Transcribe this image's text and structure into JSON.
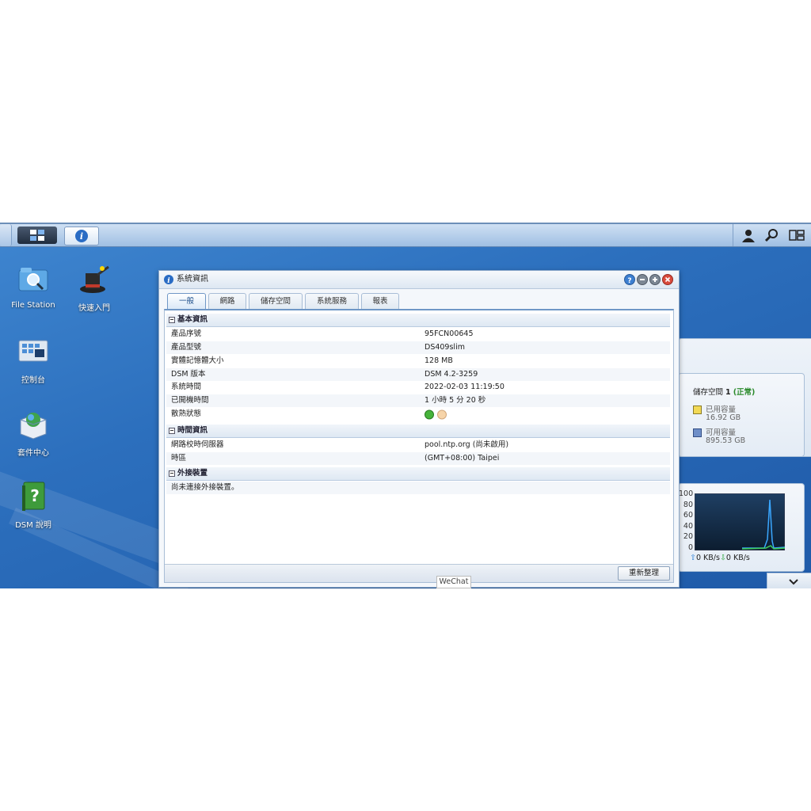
{
  "desktop": {
    "icons": [
      {
        "label": "File Station"
      },
      {
        "label": "快速入門"
      },
      {
        "label": "控制台"
      },
      {
        "label": "套件中心"
      },
      {
        "label": "DSM 說明"
      }
    ]
  },
  "window": {
    "title": "系統資訊",
    "tabs": [
      "一般",
      "網路",
      "儲存空間",
      "系統服務",
      "報表"
    ],
    "sections": {
      "basic": {
        "title": "基本資訊",
        "rows": [
          {
            "key": "產品序號",
            "value": "95FCN00645"
          },
          {
            "key": "產品型號",
            "value": "DS409slim"
          },
          {
            "key": "實體記憶體大小",
            "value": "128 MB"
          },
          {
            "key": "DSM 版本",
            "value": "DSM 4.2-3259"
          },
          {
            "key": "系統時間",
            "value": "2022-02-03 11:19:50"
          },
          {
            "key": "已開機時間",
            "value": "1 小時 5 分 20 秒"
          },
          {
            "key": "散熱狀態",
            "value": ""
          }
        ]
      },
      "time": {
        "title": "時間資訊",
        "rows": [
          {
            "key": "網路校時伺服器",
            "value": "pool.ntp.org (尚未啟用)"
          },
          {
            "key": "時區",
            "value": "(GMT+08:00) Taipei"
          }
        ]
      },
      "external": {
        "title": "外接裝置",
        "rows": [
          {
            "key": "尚未連接外接裝置。",
            "value": ""
          }
        ]
      }
    },
    "refresh_label": "重新整理"
  },
  "storage_widget": {
    "title_prefix": "儲存空間 ",
    "volume_number": "1",
    "status": "(正常)",
    "used_label": "已用容量",
    "used_value": "16.92 GB",
    "free_label": "可用容量",
    "free_value": "895.53 GB",
    "used_color": "#f2d955",
    "free_color": "#6f8fc8",
    "status_color": "#2a8a2a"
  },
  "network_widget": {
    "y_ticks": [
      "100",
      "80",
      "60",
      "40",
      "20",
      "0"
    ],
    "upload": "0 KB/s",
    "download": "0 KB/s"
  },
  "overlay": {
    "label": "WeChat"
  }
}
